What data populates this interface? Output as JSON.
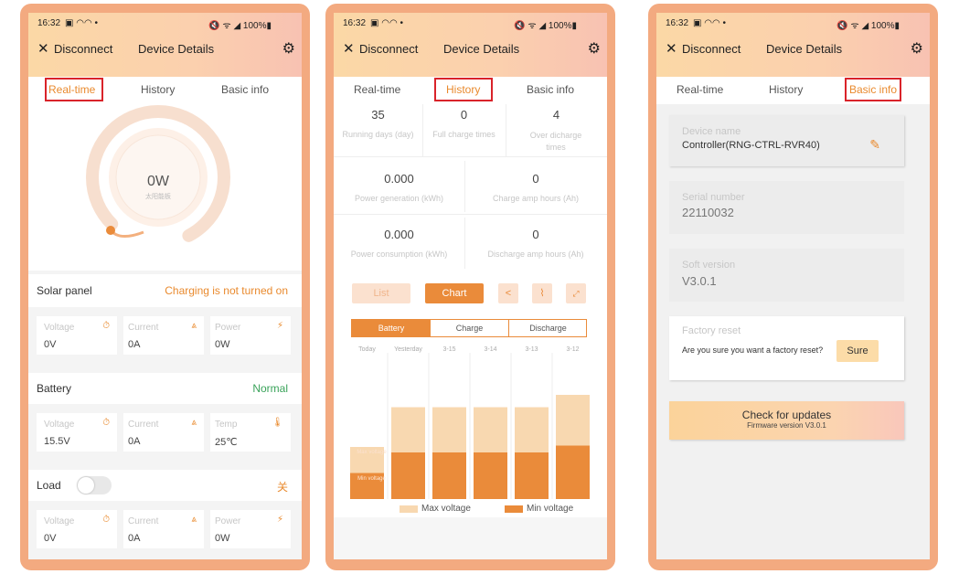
{
  "status": {
    "time": "16:32",
    "left_icons": "▣ ◠◠ •",
    "right_icons": "🔇 ᯤ ◢ 100%▮"
  },
  "header": {
    "close": "✕",
    "disconnect": "Disconnect",
    "title": "Device Details",
    "gear": "⚙"
  },
  "tabs": {
    "realtime": "Real-time",
    "history": "History",
    "basic": "Basic info"
  },
  "colors": {
    "accent": "#e98a2e",
    "highlight": "#d9232a",
    "max_voltage": "#f8d8b0",
    "min_voltage": "#ea8b3a",
    "normal": "#3aa35a"
  },
  "realtime": {
    "gauge_value": "0W",
    "gauge_sub": "太阳能板",
    "solar_title": "Solar panel",
    "solar_status": "Charging is not turned on",
    "solar": [
      {
        "label": "Voltage",
        "value": "0V",
        "icon": "⏱"
      },
      {
        "label": "Current",
        "value": "0A",
        "icon": "⩓"
      },
      {
        "label": "Power",
        "value": "0W",
        "icon": "⚡"
      }
    ],
    "battery_title": "Battery",
    "battery_status": "Normal",
    "battery": [
      {
        "label": "Voltage",
        "value": "15.5V",
        "icon": "⏱"
      },
      {
        "label": "Current",
        "value": "0A",
        "icon": "⩓"
      },
      {
        "label": "Temp",
        "value": "25℃",
        "icon": "🌡"
      }
    ],
    "load_title": "Load",
    "load_status": "关",
    "load": [
      {
        "label": "Voltage",
        "value": "0V",
        "icon": "⏱"
      },
      {
        "label": "Current",
        "value": "0A",
        "icon": "⩓"
      },
      {
        "label": "Power",
        "value": "0W",
        "icon": "⚡"
      }
    ]
  },
  "history": {
    "stats_row1": [
      {
        "value": "35",
        "label": "Running days (day)"
      },
      {
        "value": "0",
        "label": "Full charge times"
      },
      {
        "value": "4",
        "label": "Over dicharge times"
      }
    ],
    "stats_row2": [
      {
        "value": "0.000",
        "label": "Power generation (kWh)"
      },
      {
        "value": "0",
        "label": "Charge amp hours (Ah)"
      }
    ],
    "stats_row3": [
      {
        "value": "0.000",
        "label": "Power consumption (kWh)"
      },
      {
        "value": "0",
        "label": "Discharge amp hours (Ah)"
      }
    ],
    "list_btn": "List",
    "chart_btn": "Chart",
    "subtabs": {
      "battery": "Battery",
      "charge": "Charge",
      "discharge": "Discharge"
    },
    "legend_max": "Max voltage",
    "legend_min": "Min voltage",
    "today_max_label": "Max voltage",
    "today_min_label": "Min voltage",
    "today_unit": "(av)"
  },
  "chart_data": {
    "type": "bar",
    "categories": [
      "Today",
      "Yesterday",
      "3-15",
      "3-14",
      "3-13",
      "3-12"
    ],
    "series": [
      {
        "name": "Min voltage",
        "values": [
          0.19,
          0.34,
          0.34,
          0.34,
          0.34,
          0.39
        ]
      },
      {
        "name": "Max voltage",
        "values": [
          0.38,
          0.67,
          0.67,
          0.67,
          0.67,
          0.76
        ]
      }
    ],
    "ylim": [
      0,
      1
    ]
  },
  "basic": {
    "device_name_label": "Device name",
    "device_name": "Controller(RNG-CTRL-RVR40)",
    "serial_label": "Serial number",
    "serial": "22110032",
    "soft_label": "Soft version",
    "soft": "V3.0.1",
    "reset_label": "Factory reset",
    "reset_question": "Are you sure you want a factory reset?",
    "sure_btn": "Sure",
    "update_title": "Check for updates",
    "update_sub": "Firmware version V3.0.1"
  }
}
